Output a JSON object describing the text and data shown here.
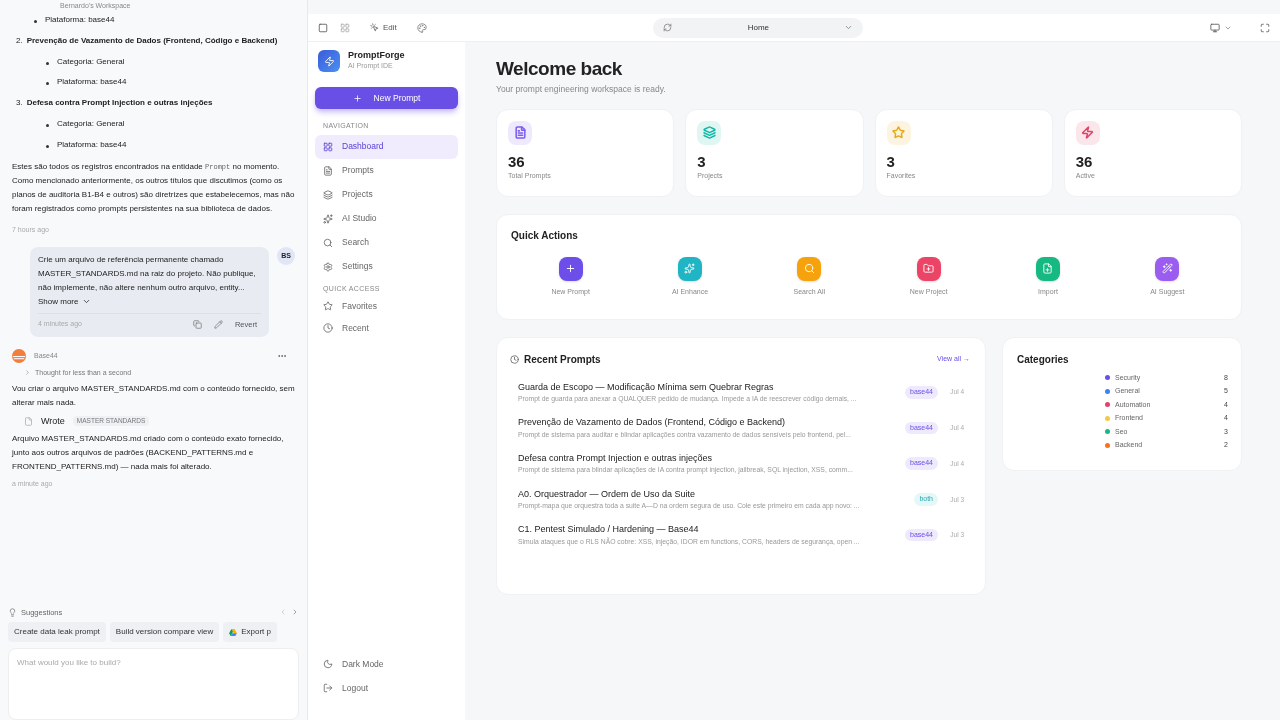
{
  "workspace": "Bernardo's Workspace",
  "chat": {
    "top_bullets": [
      "Plataforma: base44"
    ],
    "numbered": [
      {
        "number": "2.",
        "title": "Prevenção de Vazamento de Dados (Frontend, Código e Backend)",
        "bullets": [
          "Categoria: General",
          "Plataforma: base44"
        ]
      },
      {
        "number": "3.",
        "title": "Defesa contra Prompt Injection e outras injeções",
        "bullets": [
          "Categoria: General",
          "Plataforma: base44"
        ]
      }
    ],
    "summary": {
      "before": "Estes são todos os registros encontrados na entidade",
      "code": "Prompt",
      "after": "no momento. Como mencionado anteriormente, os outros títulos que discutimos (como os planos de auditoria B1-B4 e outros) são diretrizes que estabelecemos, mas não foram registrados como prompts persistentes na sua biblioteca de dados."
    },
    "summary_time": "7 hours ago",
    "user_message": {
      "avatar": "BS",
      "text": "Crie um arquivo de referência permanente chamado MASTER_STANDARDS.md na raiz do projeto. Não publique, não implemente, não altere nenhum outro arquivo, entity...",
      "show_more": "Show more",
      "time": "4 minutes ago",
      "revert": "Revert"
    },
    "assistant": {
      "name": "Base44",
      "thought": "Thought for less than a second",
      "text": "Vou criar o arquivo MASTER_STANDARDS.md com o conteúdo fornecido, sem alterar mais nada.",
      "tool_action": "Wrote",
      "tool_file": "MASTER STANDARDS",
      "result": "Arquivo MASTER_STANDARDS.md criado com o conteúdo exato fornecido, junto aos outros arquivos de padrões (BACKEND_PATTERNS.md e FRONTEND_PATTERNS.md) — nada mais foi alterado.",
      "time": "a minute ago"
    },
    "suggestions_title": "Suggestions",
    "suggestions": [
      {
        "label": "Create data leak prompt",
        "kind": "plain"
      },
      {
        "label": "Build version compare view",
        "kind": "plain"
      },
      {
        "label": "Export p",
        "kind": "drive"
      }
    ],
    "input": {
      "placeholder": "What would you like to build?"
    }
  },
  "preview": {
    "edit": "Edit",
    "url": "Home"
  },
  "app": {
    "name": "PromptForge",
    "subtitle": "AI Prompt IDE",
    "new_prompt": "New Prompt",
    "nav_title": "NAVIGATION",
    "nav": [
      {
        "label": "Dashboard",
        "selected": true
      },
      {
        "label": "Prompts",
        "selected": false
      },
      {
        "label": "Projects",
        "selected": false
      },
      {
        "label": "AI Studio",
        "selected": false
      },
      {
        "label": "Search",
        "selected": false
      },
      {
        "label": "Settings",
        "selected": false
      }
    ],
    "quick_title": "QUICK ACCESS",
    "quick": [
      {
        "label": "Favorites"
      },
      {
        "label": "Recent"
      }
    ],
    "bottom": [
      {
        "label": "Dark Mode"
      },
      {
        "label": "Logout"
      }
    ]
  },
  "dashboard": {
    "title": "Welcome back",
    "subtitle": "Your prompt engineering workspace is ready.",
    "stats": [
      {
        "value": "36",
        "label": "Total Prompts",
        "color": "#7c5cf0"
      },
      {
        "value": "3",
        "label": "Projects",
        "color": "#14b8a6"
      },
      {
        "value": "3",
        "label": "Favorites",
        "color": "#e5a91a"
      },
      {
        "value": "36",
        "label": "Active",
        "color": "#e0446a"
      }
    ],
    "quick_actions_title": "Quick Actions",
    "quick_actions": [
      {
        "label": "New Prompt",
        "color": "#6d4ee8"
      },
      {
        "label": "AI Enhance",
        "color": "#1fb5c4"
      },
      {
        "label": "Search All",
        "color": "#f5a20c"
      },
      {
        "label": "New Project",
        "color": "#ec4466"
      },
      {
        "label": "Import",
        "color": "#16b981"
      },
      {
        "label": "AI Suggest",
        "color": "#9b5cf0"
      }
    ],
    "recent_title": "Recent Prompts",
    "view_all": "View all →",
    "recent": [
      {
        "title": "Guarda de Escopo — Modificação Mínima sem Quebrar Regras",
        "description": "Prompt de guarda para anexar a QUALQUER pedido de mudança. Impede a IA de reescrever código demais, ...",
        "tag": "base44",
        "kind": "platform",
        "date": "Jul 4"
      },
      {
        "title": "Prevenção de Vazamento de Dados (Frontend, Código e Backend)",
        "description": "Prompt de sistema para auditar e blindar aplicações contra vazamento de dados sensíveis pelo frontend, pel...",
        "tag": "base44",
        "kind": "platform",
        "date": "Jul 4"
      },
      {
        "title": "Defesa contra Prompt Injection e outras injeções",
        "description": "Prompt de sistema para blindar aplicações de IA contra prompt injection, jailbreak, SQL injection, XSS, comm...",
        "tag": "base44",
        "kind": "platform",
        "date": "Jul 4"
      },
      {
        "title": "A0. Orquestrador — Ordem de Uso da Suite",
        "description": "Prompt-mapa que orquestra toda a suite A—D na ordem segura de uso. Cole este primeiro em cada app novo: ...",
        "tag": "both",
        "kind": "both",
        "date": "Jul 3"
      },
      {
        "title": "C1. Pentest Simulado / Hardening — Base44",
        "description": "Simula ataques que o RLS NÃO cobre: XSS, injeção, IDOR em functions, CORS, headers de segurança, open ...",
        "tag": "base44",
        "kind": "platform",
        "date": "Jul 3"
      }
    ],
    "categories_title": "Categories",
    "categories": [
      {
        "name": "Security",
        "count": "8",
        "color": "#6d4ee8"
      },
      {
        "name": "General",
        "count": "5",
        "color": "#3b82f6"
      },
      {
        "name": "Automation",
        "count": "4",
        "color": "#e0446a"
      },
      {
        "name": "Frontend",
        "count": "4",
        "color": "#f2c94c"
      },
      {
        "name": "Seo",
        "count": "3",
        "color": "#16b981"
      },
      {
        "name": "Backend",
        "count": "2",
        "color": "#f97316"
      }
    ]
  }
}
